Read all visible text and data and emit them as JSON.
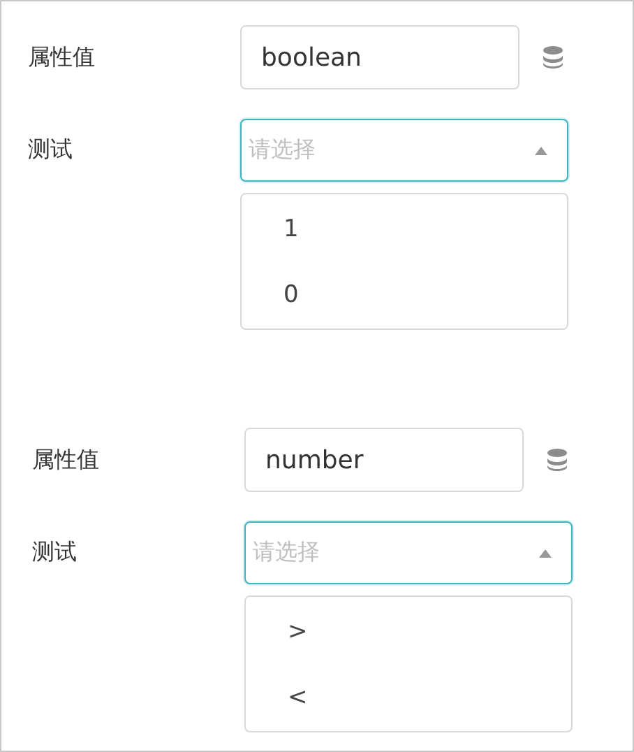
{
  "groups": [
    {
      "attribute": {
        "label": "属性值",
        "value": "boolean"
      },
      "test": {
        "label": "测试",
        "placeholder": "请选择",
        "expanded": true,
        "options": [
          "1",
          "0"
        ]
      }
    },
    {
      "attribute": {
        "label": "属性值",
        "value": "number"
      },
      "test": {
        "label": "测试",
        "placeholder": "请选择",
        "expanded": true,
        "options": [
          ">",
          "<"
        ]
      }
    }
  ]
}
